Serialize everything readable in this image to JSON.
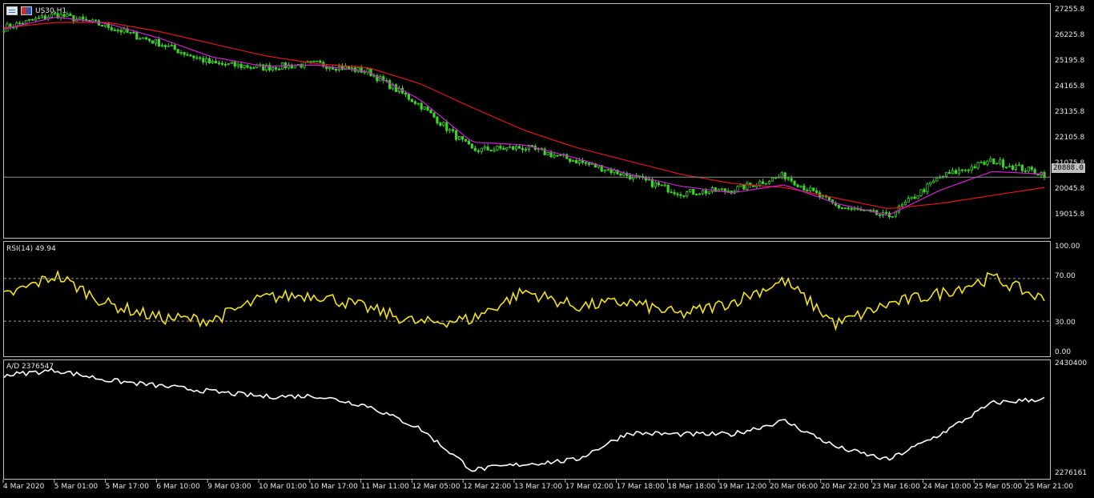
{
  "symbol": {
    "label": "US30,H1"
  },
  "price_axis": {
    "ticks": [
      "27255.8",
      "26225.8",
      "25195.8",
      "24165.8",
      "23135.8",
      "22105.8",
      "21075.8",
      "20045.8",
      "19015.8"
    ],
    "current": "20888.0"
  },
  "rsi_axis": {
    "ticks": [
      "100.00",
      "70.00",
      "30.00",
      "0.00"
    ],
    "caption": "RSI(14) 49.94"
  },
  "ad_axis": {
    "ticks": [
      "2430400",
      "2276161"
    ],
    "caption": "A/D 2376547"
  },
  "time_axis": [
    "4 Mar 2020",
    "5 Mar 01:00",
    "5 Mar 17:00",
    "6 Mar 10:00",
    "9 Mar 03:00",
    "10 Mar 01:00",
    "10 Mar 17:00",
    "11 Mar 11:00",
    "12 Mar 05:00",
    "12 Mar 22:00",
    "13 Mar 17:00",
    "17 Mar 02:00",
    "17 Mar 18:00",
    "18 Mar 18:00",
    "19 Mar 12:00",
    "20 Mar 06:00",
    "20 Mar 22:00",
    "23 Mar 16:00",
    "24 Mar 10:00",
    "25 Mar 05:00",
    "25 Mar 21:00"
  ],
  "colors": {
    "candle": "#3cd32b",
    "ma_fast": "#d020d0",
    "ma_slow": "#e01818",
    "rsi": "#f2e21a",
    "ad": "#ffffff",
    "grid": "#bdbdbd"
  },
  "chart_data": [
    {
      "type": "line",
      "title": "US30,H1",
      "ylim": [
        18700,
        27300
      ],
      "x": [
        "4 Mar 2020",
        "5 Mar 01:00",
        "5 Mar 17:00",
        "6 Mar 10:00",
        "9 Mar 03:00",
        "10 Mar 01:00",
        "10 Mar 17:00",
        "11 Mar 11:00",
        "12 Mar 05:00",
        "12 Mar 22:00",
        "13 Mar 17:00",
        "17 Mar 02:00",
        "17 Mar 18:00",
        "18 Mar 18:00",
        "19 Mar 12:00",
        "20 Mar 06:00",
        "20 Mar 22:00",
        "23 Mar 16:00",
        "24 Mar 10:00",
        "25 Mar 05:00",
        "25 Mar 21:00"
      ],
      "series": [
        {
          "values": [
            26500,
            27000,
            26550,
            25900,
            25150,
            25000,
            25150,
            24850,
            23600,
            21900,
            22000,
            21500,
            20950,
            20300,
            20400,
            20950,
            19800,
            19400,
            20900,
            21500,
            21000
          ]
        },
        {
          "values": [
            26450,
            26900,
            26650,
            26100,
            25400,
            25050,
            25100,
            24850,
            23800,
            22200,
            22100,
            21600,
            21000,
            20550,
            20300,
            20600,
            19900,
            19450,
            20400,
            21100,
            21000
          ]
        },
        {
          "values": [
            26500,
            26700,
            26700,
            26350,
            25900,
            25450,
            25150,
            25000,
            24400,
            23500,
            22650,
            22000,
            21500,
            21000,
            20650,
            20500,
            20100,
            19700,
            19900,
            20200,
            20500
          ]
        }
      ]
    },
    {
      "type": "line",
      "title": "RSI(14) 49.94",
      "ylim": [
        0,
        100
      ],
      "x": [
        "4 Mar 2020",
        "5 Mar 01:00",
        "5 Mar 17:00",
        "6 Mar 10:00",
        "9 Mar 03:00",
        "10 Mar 01:00",
        "10 Mar 17:00",
        "11 Mar 11:00",
        "12 Mar 05:00",
        "12 Mar 22:00",
        "13 Mar 17:00",
        "17 Mar 02:00",
        "17 Mar 18:00",
        "18 Mar 18:00",
        "19 Mar 12:00",
        "20 Mar 06:00",
        "20 Mar 22:00",
        "23 Mar 16:00",
        "24 Mar 10:00",
        "25 Mar 05:00",
        "25 Mar 21:00"
      ],
      "series": [
        {
          "values": [
            53,
            73,
            46,
            33,
            31,
            52,
            55,
            42,
            28,
            32,
            58,
            44,
            48,
            36,
            48,
            68,
            27,
            46,
            56,
            71,
            50
          ]
        }
      ]
    },
    {
      "type": "line",
      "title": "A/D 2376547",
      "ylim": [
        2276161,
        2430400
      ],
      "x": [
        "4 Mar 2020",
        "5 Mar 01:00",
        "5 Mar 17:00",
        "6 Mar 10:00",
        "9 Mar 03:00",
        "10 Mar 01:00",
        "10 Mar 17:00",
        "11 Mar 11:00",
        "12 Mar 05:00",
        "12 Mar 22:00",
        "13 Mar 17:00",
        "17 Mar 02:00",
        "17 Mar 18:00",
        "18 Mar 18:00",
        "19 Mar 12:00",
        "20 Mar 06:00",
        "20 Mar 22:00",
        "23 Mar 16:00",
        "24 Mar 10:00",
        "25 Mar 05:00",
        "25 Mar 21:00"
      ],
      "series": [
        {
          "values": [
            2415000,
            2422000,
            2408000,
            2400000,
            2392000,
            2385000,
            2386000,
            2372000,
            2340000,
            2282000,
            2290000,
            2296000,
            2334000,
            2332000,
            2332000,
            2351000,
            2314000,
            2296000,
            2332000,
            2376000,
            2382000
          ]
        }
      ]
    }
  ]
}
